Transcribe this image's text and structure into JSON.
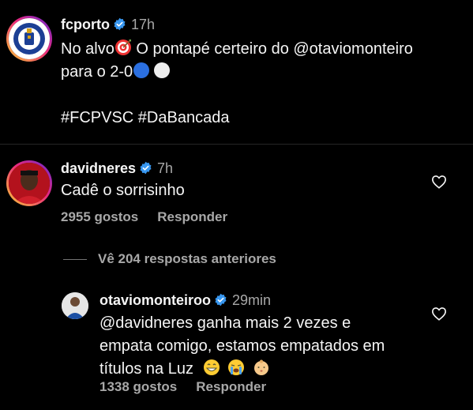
{
  "post": {
    "username": "fcporto",
    "time": "17h",
    "line1_a": "No alvo",
    "line1_b": " O pontapé certeiro do @otaviomonteiro",
    "line2": "para o 2-0",
    "hashtags": "#FCPVSC #DaBancada"
  },
  "comment": {
    "username": "davidneres",
    "time": "7h",
    "text": "Cadê o sorrisinho",
    "likes": "2955 gostos",
    "reply_label": "Responder"
  },
  "view_replies": "Vê 204 respostas anteriores",
  "reply": {
    "username": "otaviomonteiroo",
    "time": "29min",
    "line1": "@davidneres ganha mais 2 vezes e",
    "line2": "empata comigo, estamos empatados em",
    "line3": "títulos na Luz",
    "likes": "1338 gostos",
    "reply_label": "Responder"
  },
  "colors": {
    "background": "#000000",
    "text": "#f5f5f5",
    "secondary": "#a8a8a8",
    "verified": "#3897f0"
  }
}
